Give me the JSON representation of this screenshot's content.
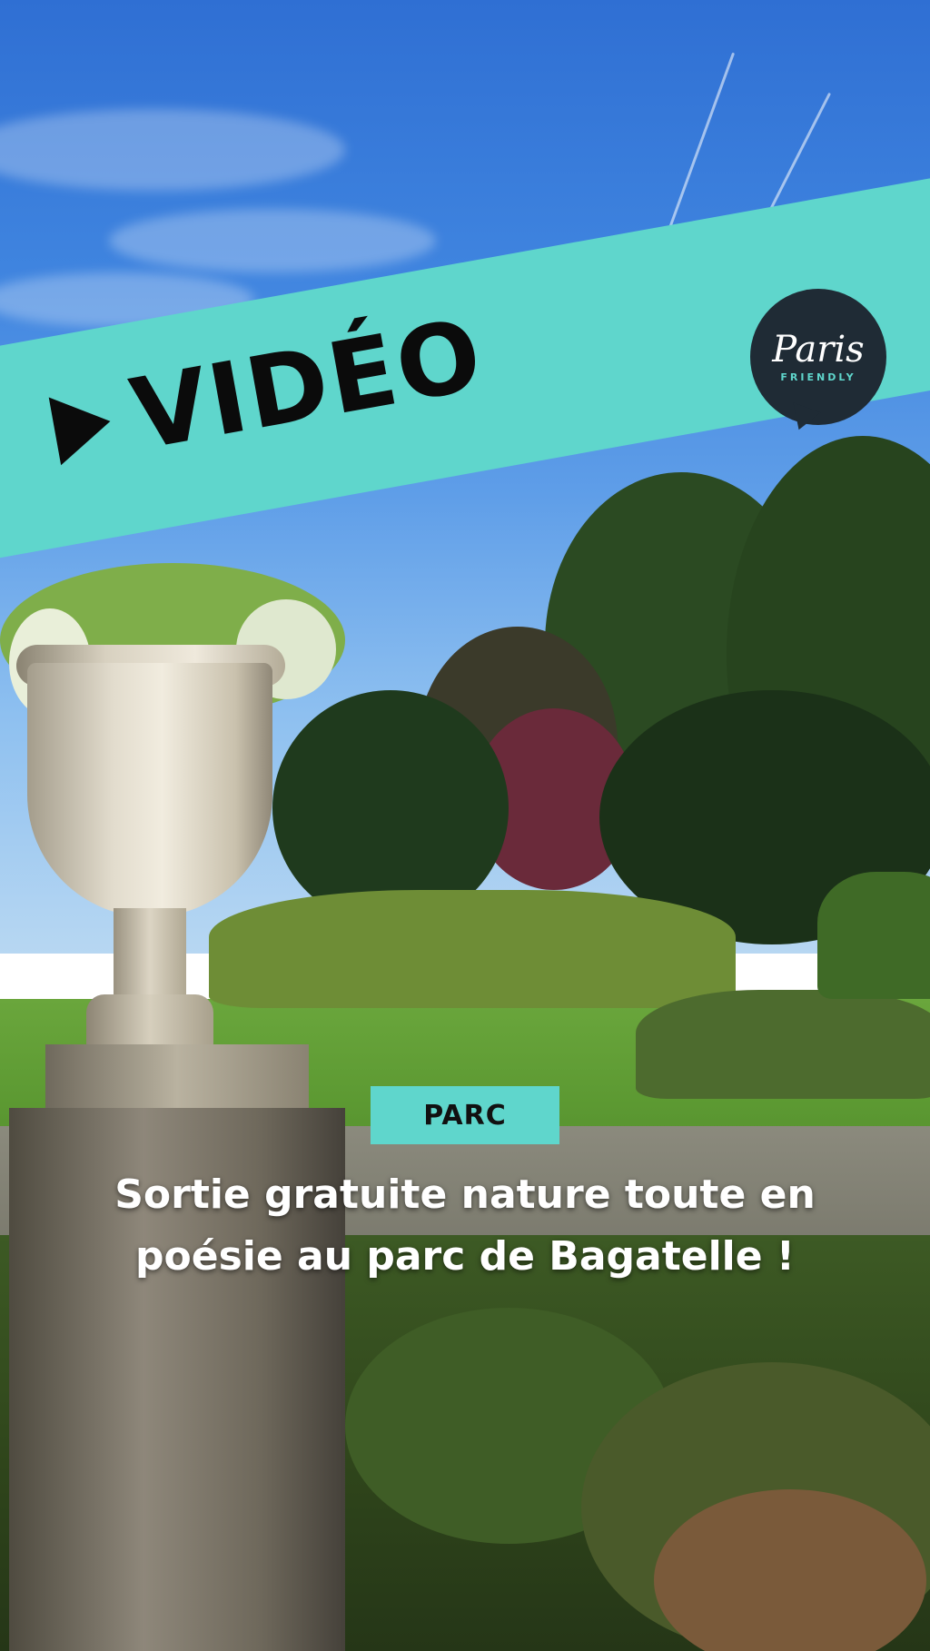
{
  "banner": {
    "label": "VIDÉO",
    "play_icon": "play-icon",
    "color": "#5fd6cc"
  },
  "logo": {
    "line1": "Paris",
    "line2": "FRIENDLY",
    "bg_color": "#1f2b35"
  },
  "tag": {
    "label": "PARC"
  },
  "headline": {
    "line1": "Sortie gratuite nature toute en",
    "line2": "poésie au parc de Bagatelle !"
  }
}
